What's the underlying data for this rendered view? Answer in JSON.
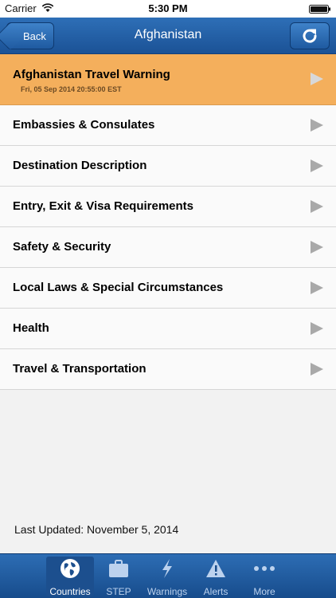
{
  "status_bar": {
    "carrier": "Carrier",
    "time": "5:30 PM"
  },
  "nav": {
    "back_label": "Back",
    "title": "Afghanistan"
  },
  "warning": {
    "title": "Afghanistan Travel Warning",
    "date": "Fri, 05 Sep 2014 20:55:00 EST",
    "color": "#f4af5c"
  },
  "items": [
    {
      "label": "Embassies & Consulates"
    },
    {
      "label": "Destination Description"
    },
    {
      "label": "Entry, Exit & Visa Requirements"
    },
    {
      "label": "Safety & Security"
    },
    {
      "label": "Local Laws & Special Circumstances"
    },
    {
      "label": "Health"
    },
    {
      "label": "Travel & Transportation"
    }
  ],
  "last_updated": "Last Updated: November 5, 2014",
  "tabs": [
    {
      "label": "Countries",
      "icon": "globe-icon",
      "active": true
    },
    {
      "label": "STEP",
      "icon": "briefcase-icon"
    },
    {
      "label": "Warnings",
      "icon": "lightning-icon"
    },
    {
      "label": "Alerts",
      "icon": "warning-triangle-icon"
    },
    {
      "label": "More",
      "icon": "more-dots-icon"
    }
  ],
  "colors": {
    "nav": "#1f5aa0",
    "tab_bar": "#174c8c",
    "accent_warning": "#f4af5c"
  }
}
